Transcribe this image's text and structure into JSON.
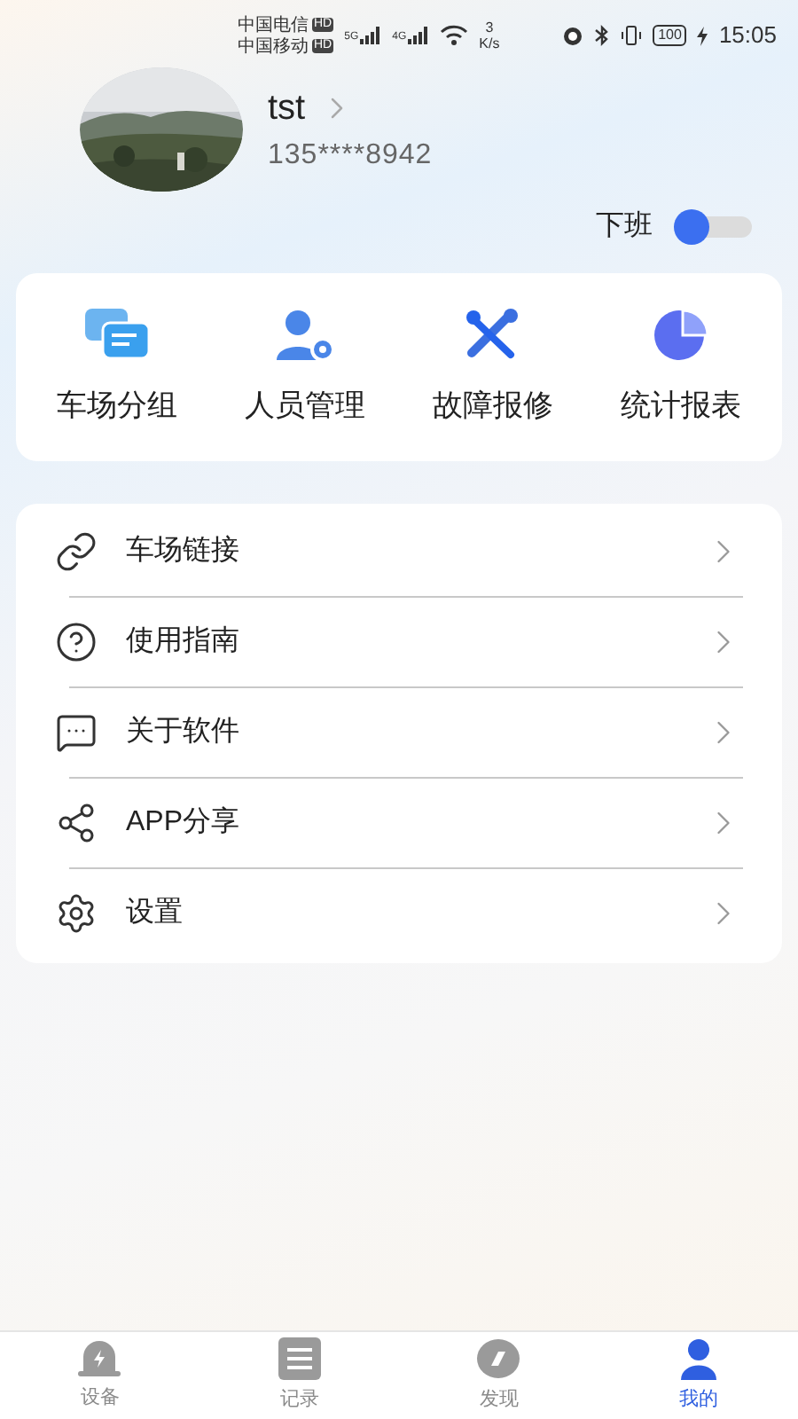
{
  "status_bar": {
    "carriers": [
      {
        "name": "中国电信",
        "badge": "HD"
      },
      {
        "name": "中国移动",
        "badge": "HD"
      }
    ],
    "signals": [
      "5G",
      "4G"
    ],
    "speed_value": "3",
    "speed_unit": "K/s",
    "battery": "100",
    "time": "15:05"
  },
  "profile": {
    "name": "tst",
    "phone": "135****8942"
  },
  "duty": {
    "label": "下班",
    "on": false
  },
  "shortcuts": [
    {
      "label": "车场分组",
      "kind": "chat"
    },
    {
      "label": "人员管理",
      "kind": "person"
    },
    {
      "label": "故障报修",
      "kind": "tools"
    },
    {
      "label": "统计报表",
      "kind": "pie"
    }
  ],
  "menu": [
    {
      "label": "车场链接",
      "kind": "link"
    },
    {
      "label": "使用指南",
      "kind": "help"
    },
    {
      "label": "关于软件",
      "kind": "about"
    },
    {
      "label": "APP分享",
      "kind": "share"
    },
    {
      "label": "设置",
      "kind": "settings"
    }
  ],
  "tabs": [
    {
      "label": "设备",
      "kind": "device",
      "selected": false
    },
    {
      "label": "记录",
      "kind": "record",
      "selected": false
    },
    {
      "label": "发现",
      "kind": "discover",
      "selected": false
    },
    {
      "label": "我的",
      "kind": "me",
      "selected": true
    }
  ]
}
